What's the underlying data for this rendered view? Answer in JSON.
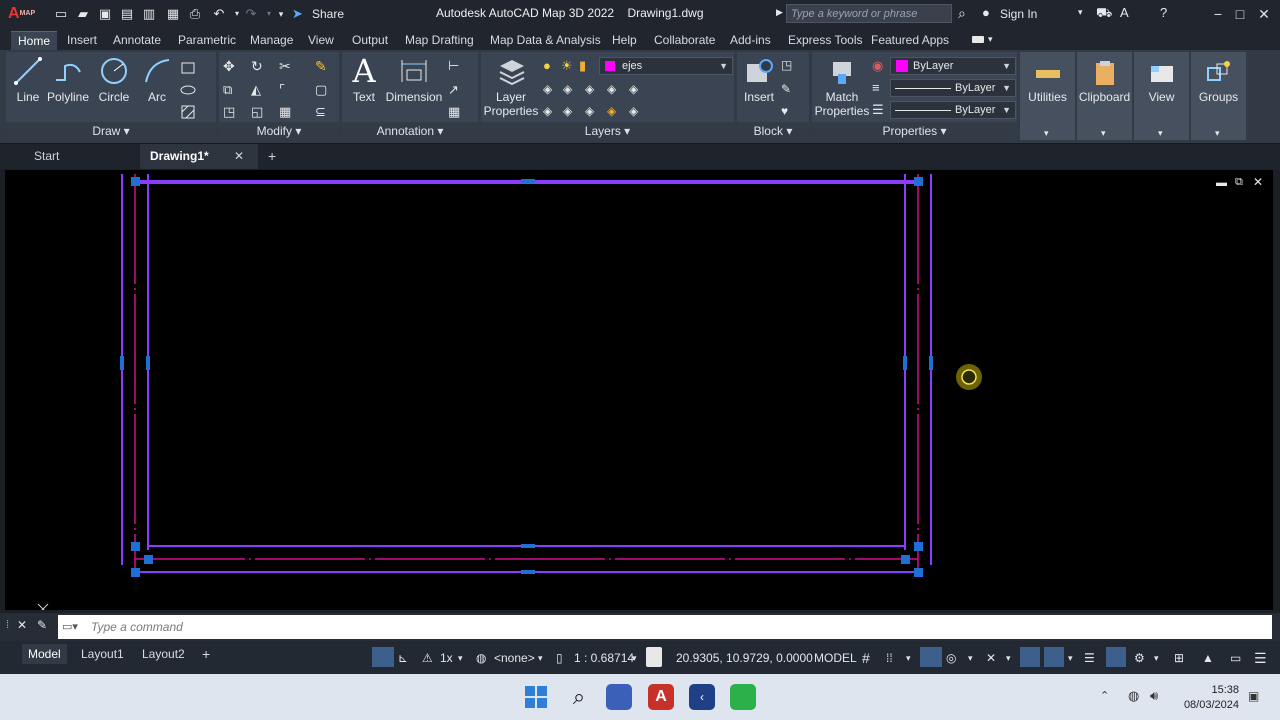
{
  "app": {
    "logo_text": "A",
    "logo_badge": "MAP",
    "title": "Autodesk AutoCAD Map 3D 2022",
    "document": "Drawing1.dwg",
    "share": "Share",
    "search_placeholder": "Type a keyword or phrase",
    "sign_in": "Sign In"
  },
  "ribbon_tabs": [
    "Home",
    "Insert",
    "Annotate",
    "Parametric",
    "Manage",
    "View",
    "Output",
    "Map Drafting",
    "Map Data & Analysis",
    "Help",
    "Collaborate",
    "Add-ins",
    "Express Tools",
    "Featured Apps"
  ],
  "active_tab": "Home",
  "panels": {
    "draw": {
      "title": "Draw",
      "tools": [
        "Line",
        "Polyline",
        "Circle",
        "Arc"
      ]
    },
    "modify": {
      "title": "Modify"
    },
    "annotation": {
      "title": "Annotation",
      "tools": [
        "Text",
        "Dimension"
      ]
    },
    "layers": {
      "title": "Layers",
      "tool": "Layer Properties",
      "current_layer": "ejes"
    },
    "block": {
      "title": "Block",
      "tool": "Insert"
    },
    "properties": {
      "title": "Properties",
      "tool": "Match Properties",
      "color": "ByLayer",
      "linetype": "ByLayer",
      "lineweight": "ByLayer"
    },
    "utilities": "Utilities",
    "clipboard": "Clipboard",
    "view": "View",
    "groups": "Groups"
  },
  "file_tabs": {
    "start": "Start",
    "active": "Drawing1*"
  },
  "command": {
    "placeholder": "Type a command"
  },
  "layout_tabs": [
    "Model",
    "Layout1",
    "Layout2"
  ],
  "status": {
    "scale_mult": "1x",
    "none": "<none>",
    "scale": "1 : 0.68714",
    "coords": "20.9305, 10.9729, 0.0000",
    "space": "MODEL"
  },
  "clock": {
    "time": "15:38",
    "date": "08/03/2024"
  },
  "colors": {
    "magenta": "#ff00ff",
    "frame": "#8b3dff",
    "grip": "#1e6fd6"
  }
}
